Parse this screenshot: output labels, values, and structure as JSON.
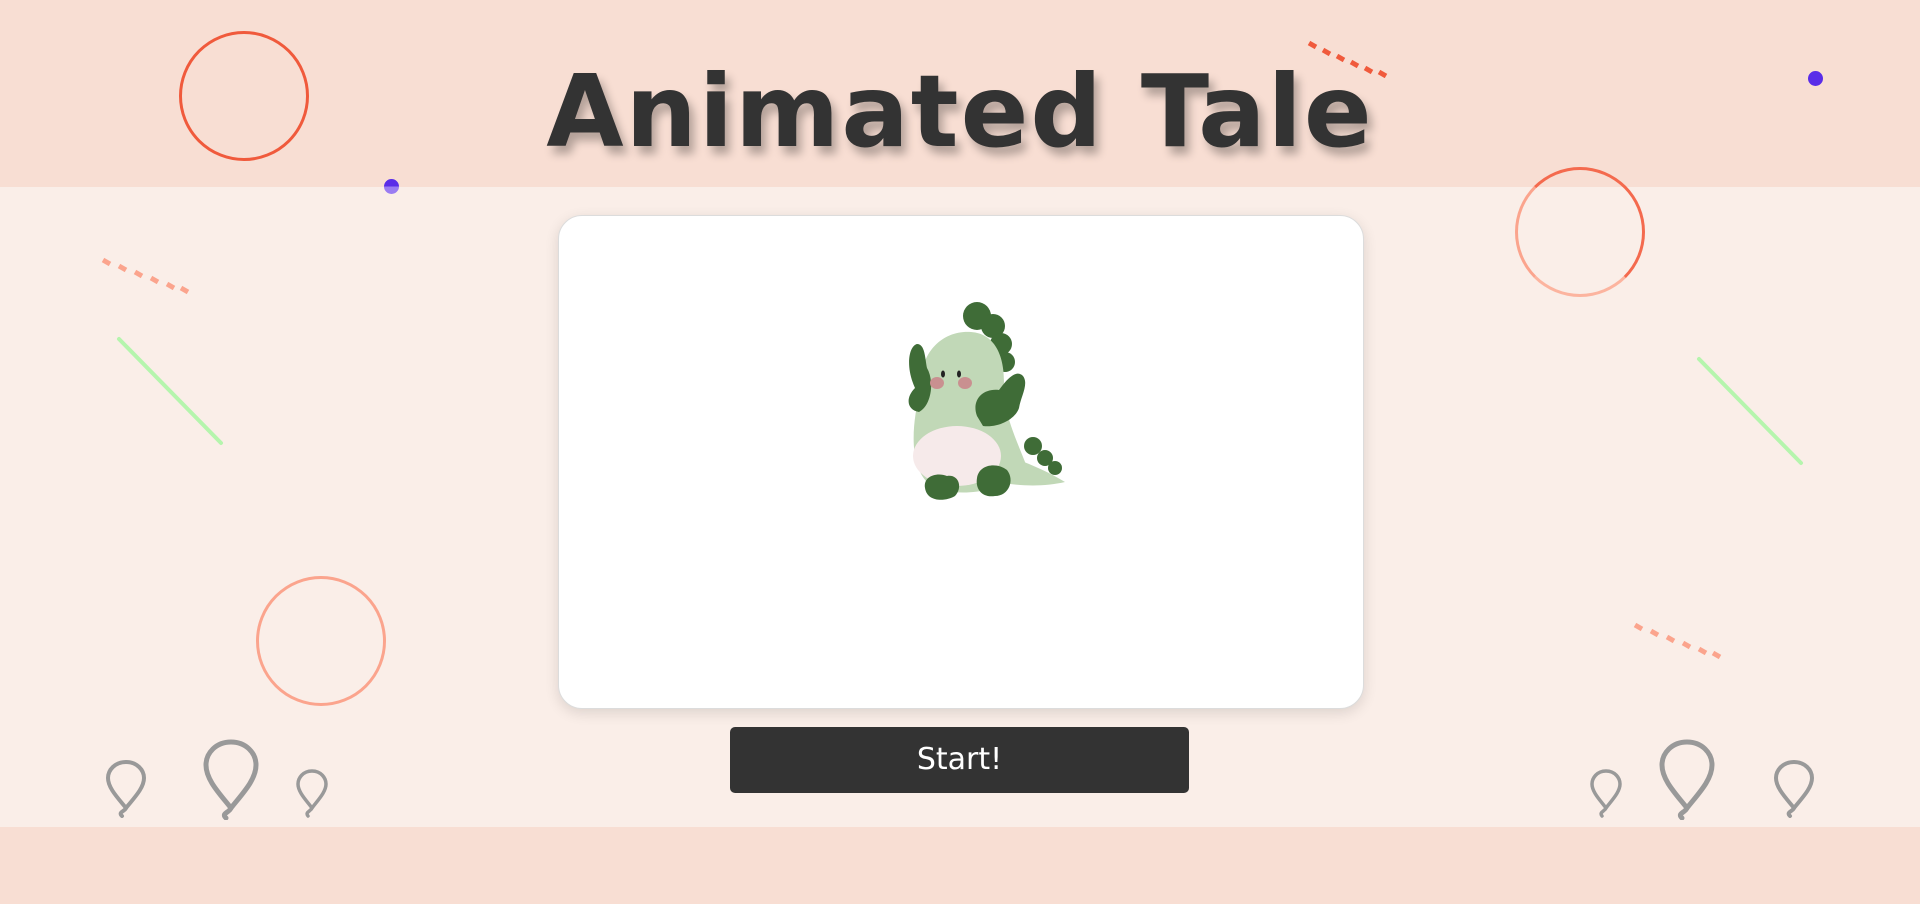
{
  "title": "Animated Tale",
  "start_button": {
    "label": "Start!"
  },
  "colors": {
    "band": "#f8ded3",
    "background": "#faeee8",
    "title": "#333333",
    "button": "#333333",
    "ring_dark": "#f05a3c",
    "ring_light": "#fba48d",
    "dot": "#5a2de8",
    "green_line": "#b5f5ad",
    "balloon": "#999999"
  },
  "decorations": [
    "ring",
    "ring",
    "ring",
    "ring",
    "dot",
    "dot",
    "dash-stripe",
    "dash-stripe",
    "dash-stripe",
    "green-line",
    "green-line",
    "balloon-icon",
    "balloon-icon",
    "balloon-icon",
    "balloon-icon",
    "balloon-icon",
    "balloon-icon"
  ]
}
